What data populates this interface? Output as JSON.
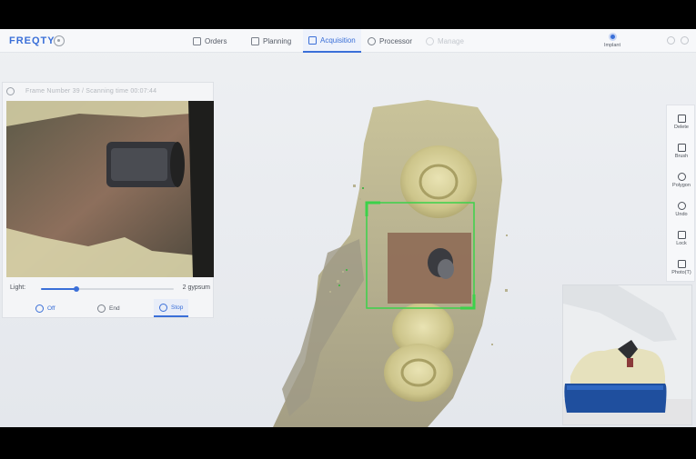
{
  "app": {
    "logo": "FREQTY"
  },
  "nav": [
    {
      "label": "Orders",
      "icon": "orders-icon",
      "state": "normal"
    },
    {
      "label": "Planning",
      "icon": "planning-icon",
      "state": "normal"
    },
    {
      "label": "Acquisition",
      "icon": "acquisition-icon",
      "state": "active"
    },
    {
      "label": "Processor",
      "icon": "processor-icon",
      "state": "normal"
    },
    {
      "label": "Manage",
      "icon": "manage-icon",
      "state": "disabled"
    }
  ],
  "mode": {
    "label": "Implant"
  },
  "camera": {
    "header": "Frame Number 39 / Scanning time 00:07:44",
    "light_label": "Light:",
    "light_level": 0.27,
    "light_value": "2 gypsum",
    "buttons": {
      "off": "Off",
      "end": "End",
      "stop": "Stop"
    }
  },
  "tools": [
    {
      "label": "Delete",
      "icon": "trash-icon"
    },
    {
      "label": "Brush",
      "icon": "brush-icon"
    },
    {
      "label": "Polygon",
      "icon": "polygon-icon"
    },
    {
      "label": "Undo",
      "icon": "undo-icon"
    },
    {
      "label": "Lock",
      "icon": "lock-icon"
    },
    {
      "label": "Photo(T)",
      "icon": "photo-icon"
    }
  ],
  "bottom_tools": [
    {
      "icon": "lower-jaw-icon",
      "status": "done"
    },
    {
      "icon": "flip-icon"
    },
    {
      "icon": "upper-jaw-icon",
      "status": "done"
    },
    {
      "icon": "scan-body-icon",
      "status": "active"
    },
    {
      "icon": "upper-jaw-icon",
      "status": "error"
    },
    {
      "icon": "next-icon"
    }
  ],
  "colors": {
    "accent": "#3a6fd8",
    "scan_frame": "#3bd24a",
    "jaw": "#f1a5b6"
  }
}
